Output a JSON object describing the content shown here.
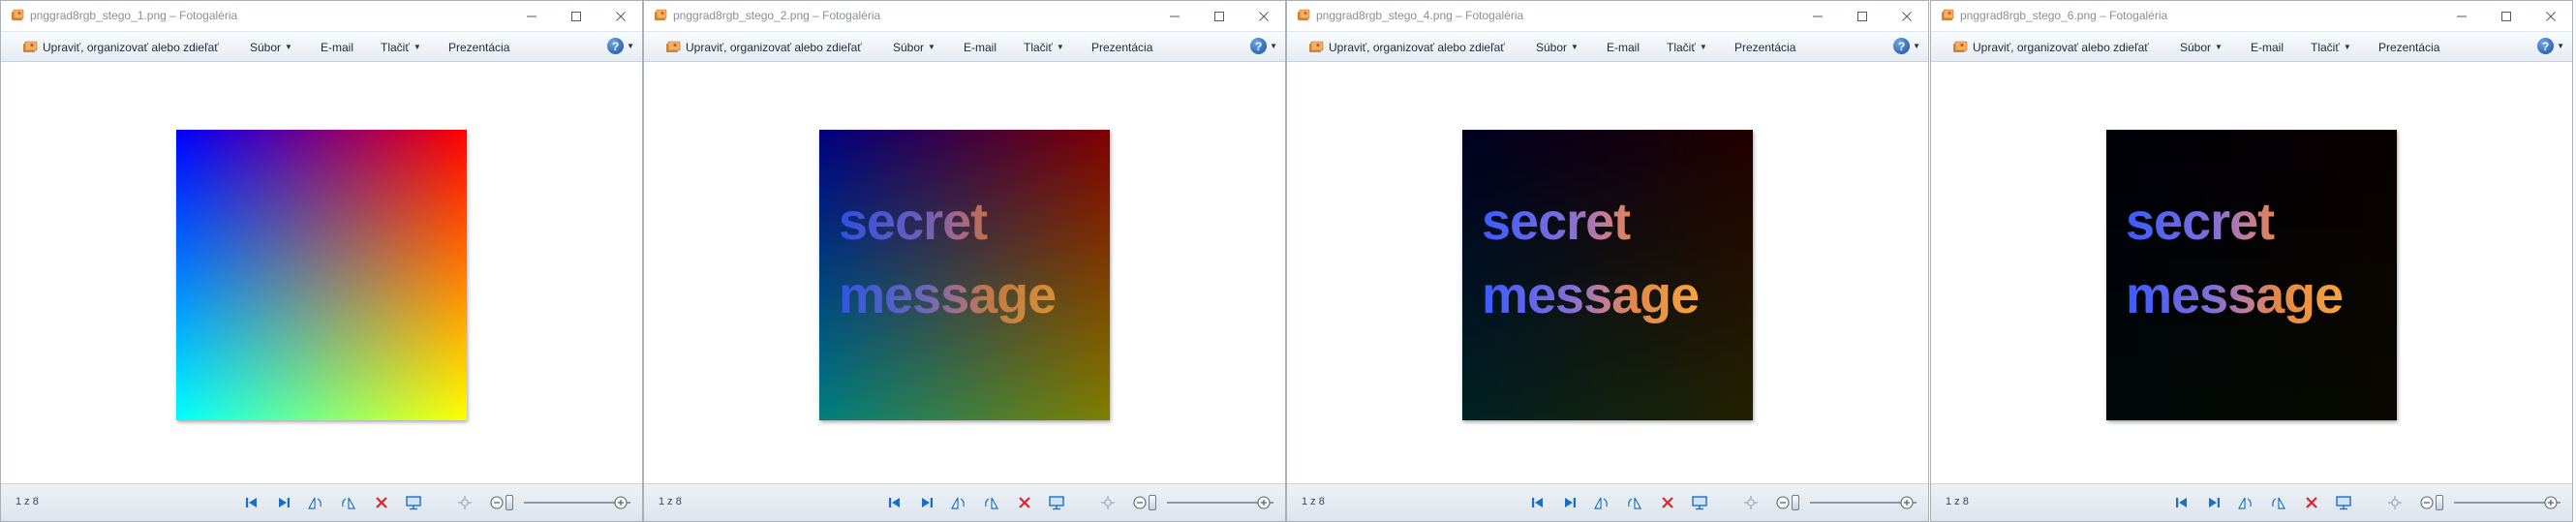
{
  "windows": [
    {
      "title": "pnggrad8rgb_stego_1.png – Fotogaléria",
      "variant": 1,
      "counter": "1 z 8"
    },
    {
      "title": "pnggrad8rgb_stego_2.png – Fotogaléria",
      "variant": 2,
      "counter": "1 z 8"
    },
    {
      "title": "pnggrad8rgb_stego_4.png – Fotogaléria",
      "variant": 4,
      "counter": "1 z 8"
    },
    {
      "title": "pnggrad8rgb_stego_6.png – Fotogaléria",
      "variant": 6,
      "counter": "1 z 8"
    }
  ],
  "toolbar": {
    "edit_label": "Upraviť, organizovať alebo zdieľať",
    "file_label": "Súbor",
    "email_label": "E-mail",
    "print_label": "Tlačiť",
    "slideshow_label": "Prezentácia"
  },
  "image_text": {
    "line1": "secret",
    "line2": "message"
  },
  "colors": {
    "toolbar_bg": "#e6ecf3",
    "status_bg": "#dce4ed",
    "accent_blue": "#1c6fc4",
    "delete_red": "#d9262b"
  }
}
